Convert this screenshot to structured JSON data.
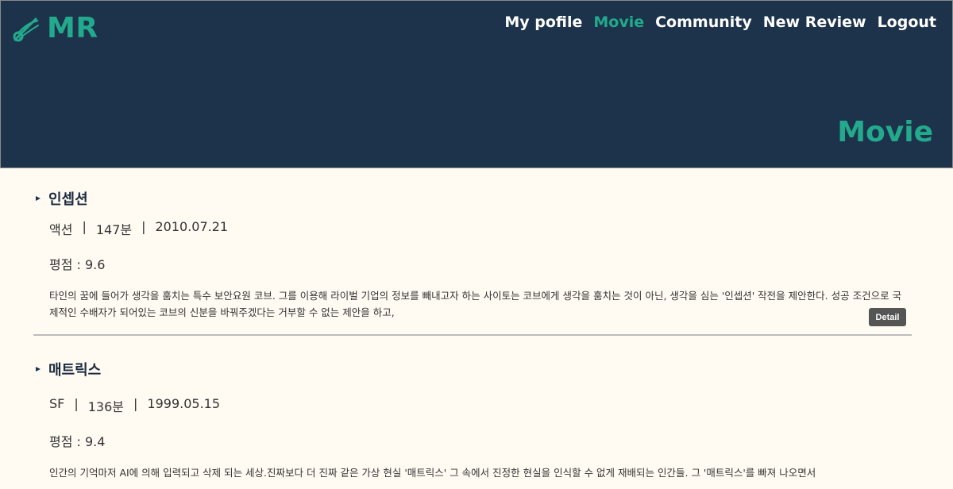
{
  "header": {
    "logo_text": "MR",
    "nav": [
      "My pofile",
      "Movie",
      "Community",
      "New Review",
      "Logout"
    ],
    "active_nav": "Movie",
    "page_title": "Movie",
    "colors": {
      "header_bg": "#1c334b",
      "accent": "#23a98c"
    }
  },
  "movies": [
    {
      "title": "인셉션",
      "genre": "액션",
      "runtime": "147분",
      "release": "2010.07.21",
      "rating": "평점 : 9.6",
      "description": "타인의 꿈에 들어가 생각을 훔치는 특수 보안요원 코브. 그를 이용해 라이벌 기업의 정보를 빼내고자 하는 사이토는 코브에게 생각을 훔치는 것이 아닌, 생각을 심는 '인셉션' 작전을 제안한다. 성공 조건으로 국제적인 수배자가 되어있는 코브의 신분을 바꿔주겠다는 거부할 수 없는 제안을 하고,",
      "detail_label": "Detail"
    },
    {
      "title": "매트릭스",
      "genre": "SF",
      "runtime": "136분",
      "release": "1999.05.15",
      "rating": "평점 : 9.4",
      "description": "인간의 기억마저 AI에 의해 입력되고 삭제 되는 세상.진짜보다 더 진짜 같은 가상 현실 '매트릭스' 그 속에서 진정한 현실을 인식할 수 없게 재배되는 인간들. 그 '매트릭스'를 빠져 나오면서"
    }
  ],
  "separator": "|"
}
